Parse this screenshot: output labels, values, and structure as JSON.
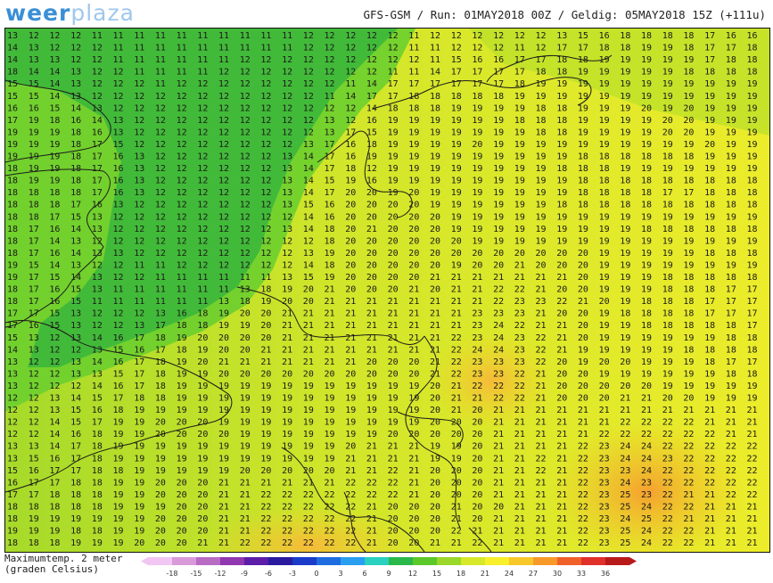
{
  "brand": {
    "part1": "weer",
    "part2": "plaza"
  },
  "header": {
    "run_info": "GFS-GSM / Run: 01MAY2018 00Z / Geldig: 05MAY2018 15Z (+111u)"
  },
  "legend": {
    "line1": "Maximumtemp. 2 meter",
    "line2": "(graden Celsius)",
    "ticks": [
      "-18",
      "-15",
      "-12",
      "-9",
      "-6",
      "-3",
      "0",
      "3",
      "6",
      "9",
      "12",
      "15",
      "18",
      "21",
      "24",
      "27",
      "30",
      "33",
      "36"
    ],
    "colors": [
      "#f2c6f2",
      "#d99ad9",
      "#b86cc4",
      "#9137b0",
      "#5c1ea8",
      "#2a1aa0",
      "#1a3cc8",
      "#1e6ce0",
      "#2a9ef0",
      "#2ad0c0",
      "#2ab84a",
      "#5cc82a",
      "#9ad82a",
      "#d8e82a",
      "#f8f02a",
      "#f8c82a",
      "#f89a2a",
      "#f0602a",
      "#e0302a",
      "#b81a1a"
    ]
  },
  "map": {
    "rows": [
      "13 12 12 12 11 11 11 11 11 11 11 11 11 11 12 12 12 12 12 11 12 12 12 12 12 12 13 15 16 18 18 18 18 17 16 16",
      "14 13 12 12 12 11 11 11 11 11 11 11 11 11 12 12 12 12 12 11 11 12 12 12 11 12 17 17 18 18 19 19 18 17 17 18",
      "14 13 13 12 12 11 11 11 11 11 11 12 12 12 12 12 12 12 12 12 11 15 16 16 17 17 18 18 19 19 19 19 19 17 18 18",
      "18 14 14 13 12 12 11 11 11 11 12 12 12 12 12 12 12 12 11 11 14 17 17 17 17 18 18 19 19 19 19 19 18 18 18 18",
      "15 15 14 13 12 12 12 11 12 12 12 12 12 12 12 12 11 14 17 17 17 17 17 17 18 19 19 19 19 19 19 19 19 19 19 19",
      "15 15 14 13 12 12 12 12 12 12 12 12 12 12 12 11 14 17 17 18 18 18 18 18 19 19 19 19 19 19 19 19 19 19 19 19",
      "16 16 15 14 13 12 12 12 12 12 12 12 12 12 12 12 12 14 18 18 18 19 19 19 19 18 18 19 19 19 20 19 20 19 19 19",
      "17 19 18 16 14 13 12 12 12 12 12 12 12 12 12 13 12 16 19 19 19 19 19 19 18 18 18 19 19 19 19 20 20 19 19 19",
      "19 19 19 18 16 13 12 12 12 12 12 12 12 12 12 13 17 15 19 19 19 19 19 19 19 18 18 19 19 19 19 20 20 19 19 19",
      "19 19 19 18 17 15 12 12 12 12 12 12 12 12 13 17 16 18 19 19 19 19 20 19 19 19 19 19 19 19 19 19 19 20 19 19",
      "19 19 19 18 17 16 13 12 12 12 12 12 12 13 14 17 16 19 19 19 19 19 19 19 19 19 19 18 18 18 18 18 18 19 19 19",
      "18 19 19 18 17 16 13 12 12 12 12 12 12 13 14 17 18 12 19 19 19 19 19 19 19 19 18 18 18 19 19 19 19 19 19 19",
      "18 19 19 18 17 16 13 12 12 12 12 12 12 13 14 15 19 16 19 19 19 19 19 19 19 19 19 18 18 18 18 18 18 18 18 18",
      "18 18 18 18 17 16 13 12 12 12 12 12 12 13 14 17 20 20 19 20 19 19 19 19 19 19 19 18 18 18 18 17 17 18 18 18",
      "18 18 18 17 16 13 12 12 12 12 12 12 12 13 15 16 20 20 20 20 19 19 19 19 19 19 18 18 18 18 18 18 18 18 18 18",
      "18 18 17 15 13 12 12 12 12 12 12 12 12 12 14 16 20 20 20 20 20 19 19 19 19 19 19 19 19 19 19 19 19 19 19 19",
      "18 17 16 14 13 12 12 12 12 12 12 12 12 13 14 18 20 21 20 20 20 19 19 19 19 19 19 19 19 19 18 18 18 18 18 18",
      "18 17 14 13 12 12 12 12 12 12 12 12 12 12 12 18 20 20 20 20 20 20 19 19 19 19 19 19 19 19 19 19 19 19 19 19",
      "18 17 16 14 13 13 12 12 12 12 12 12 12 12 13 19 20 20 20 20 20 20 20 20 20 20 20 20 19 19 19 19 19 18 18 18",
      "19 15 14 13 12 12 11 11 12 12 12 12 12 12 14 18 20 20 20 20 20 19 20 20 21 20 20 20 19 19 19 19 19 19 19 19",
      "19 17 15 14 13 12 12 11 11 11 11 11 11 13 15 19 20 20 20 20 21 21 21 21 21 21 21 20 19 19 19 18 18 18 18 18",
      "18 17 16 15 13 11 11 11 11 11 11 13 18 19 20 21 20 20 20 21 20 21 21 22 22 21 20 20 19 19 19 18 18 18 17 17",
      "18 17 16 15 11 11 11 11 11 11 13 18 19 20 20 21 21 21 21 21 21 21 21 22 23 23 22 21 20 19 18 18 18 17 17 17",
      "17 17 15 13 12 12 12 13 16 18 19 20 20 21 21 21 21 21 21 21 21 21 23 23 23 21 20 20 19 18 18 18 18 17 17 17",
      "17 16 15 13 12 12 13 17 18 18 19 19 20 21 21 21 21 21 21 21 21 21 23 24 22 21 21 20 19 19 18 18 18 18 18 17",
      "15 13 12 13 14 16 17 18 19 20 20 20 20 21 21 21 21 21 21 21 21 22 23 24 23 22 21 20 19 19 19 19 19 19 18 18",
      "14 13 12 12 13 15 16 17 18 19 20 20 21 21 21 21 21 21 21 21 21 22 24 24 23 22 21 19 19 19 19 19 18 18 18 18",
      "13 12 12 13 14 16 17 18 19 20 21 21 21 21 21 21 21 20 20 20 21 22 23 23 23 22 20 19 20 20 19 19 19 18 17 17",
      "13 12 12 13 13 15 17 18 19 19 20 20 20 20 20 20 20 20 20 20 21 22 23 23 22 21 20 20 19 19 19 19 19 19 18 18",
      "13 12 12 12 14 16 17 18 19 19 19 19 19 19 19 19 19 19 19 19 20 21 22 22 22 21 20 20 20 20 20 19 19 19 19 19",
      "12 12 13 14 15 17 18 18 19 19 19 19 19 19 19 19 19 19 19 19 20 21 21 22 22 21 20 20 20 21 21 20 20 19 19 19",
      "12 12 13 15 16 18 19 19 19 19 19 19 19 19 19 19 19 19 19 19 20 21 20 21 21 21 21 21 21 21 21 21 21 21 21 21",
      "12 12 14 15 17 19 19 20 20 20 19 19 19 19 19 19 19 19 19 19 20 20 20 21 21 21 21 21 21 22 22 22 22 21 21 21",
      "12 12 14 16 18 19 19 20 20 20 20 19 19 19 19 19 19 19 20 20 20 20 20 21 21 21 21 21 22 22 22 22 22 22 21 21",
      "13 13 14 17 18 19 19 19 19 19 19 19 19 19 19 19 20 21 21 21 19 19 20 21 21 21 21 22 23 24 24 22 22 22 22 22",
      "13 15 16 17 18 19 19 19 19 19 19 19 19 19 19 19 21 21 21 21 19 19 20 21 21 22 21 22 23 24 24 23 22 22 22 22",
      "15 16 17 17 18 18 19 19 19 19 19 20 20 20 20 20 21 21 22 21 20 20 20 21 21 22 21 22 23 23 24 22 22 22 22 22",
      "16 17 17 18 18 19 19 20 20 20 21 21 21 21 21 21 22 22 22 21 20 20 20 21 21 21 21 22 23 24 23 22 22 22 22 22",
      "17 17 18 18 18 19 19 20 20 20 21 21 22 22 22 22 22 22 22 21 20 20 20 21 21 21 21 22 23 25 23 22 21 21 22 22",
      "18 18 18 18 18 19 19 19 20 20 21 21 22 22 22 22 22 21 20 20 20 21 20 20 21 21 21 22 23 25 24 22 22 21 21 21",
      "18 19 19 19 19 19 19 20 20 20 21 21 22 22 22 22 22 21 20 20 20 21 20 21 21 21 21 22 23 24 25 22 21 21 21 21",
      "19 19 19 18 18 19 19 20 20 20 21 21 22 22 22 22 22 21 20 20 20 22 21 21 21 21 21 22 23 25 24 22 22 21 21 21",
      "18 18 18 19 19 19 20 20 20 21 21 22 22 22 22 22 22 21 20 20 21 21 22 21 21 21 21 22 23 25 24 22 22 21 21 21"
    ]
  }
}
